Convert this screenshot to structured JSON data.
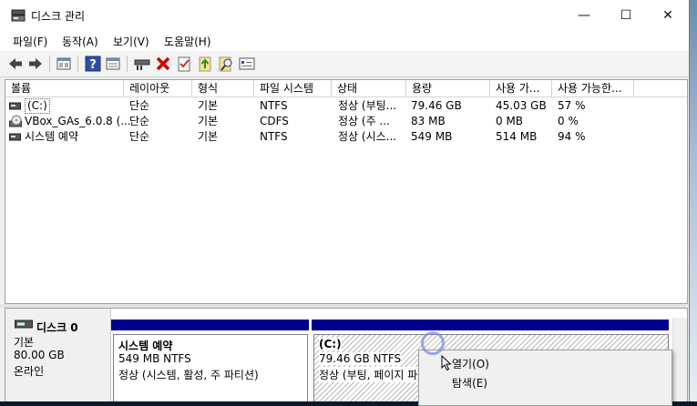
{
  "window": {
    "title": "디스크 관리",
    "controls": {
      "minimize": "—",
      "maximize": "☐",
      "close": "✕"
    }
  },
  "menubar": [
    "파일(F)",
    "동작(A)",
    "보기(V)",
    "도움말(H)"
  ],
  "toolbar": {
    "icons": [
      "back-icon",
      "forward-icon",
      "properties-icon",
      "help-icon",
      "view-icon",
      "connect-icon",
      "delete-icon",
      "check-icon",
      "import-icon",
      "search-icon",
      "rescan-icon"
    ]
  },
  "volume_list": {
    "columns": [
      "볼륨",
      "레이아웃",
      "형식",
      "파일 시스템",
      "상태",
      "용량",
      "사용 가...",
      "사용 가능한..."
    ],
    "rows": [
      {
        "volume": "(C:)",
        "layout": "단순",
        "type": "기본",
        "fs": "NTFS",
        "status": "정상 (부팅...",
        "capacity": "79.46 GB",
        "free": "45.03 GB",
        "pct": "57 %"
      },
      {
        "volume": "VBox_GAs_6.0.8 (...",
        "layout": "단순",
        "type": "기본",
        "fs": "CDFS",
        "status": "정상 (주 ...",
        "capacity": "83 MB",
        "free": "0 MB",
        "pct": "0 %"
      },
      {
        "volume": "시스템 예약",
        "layout": "단순",
        "type": "기본",
        "fs": "NTFS",
        "status": "정상 (시스...",
        "capacity": "549 MB",
        "free": "514 MB",
        "pct": "94 %"
      }
    ]
  },
  "disk0": {
    "name": "디스크 0",
    "kind": "기본",
    "size": "80.00 GB",
    "state": "온라인",
    "partitions": [
      {
        "name": "시스템 예약",
        "size": "549 MB NTFS",
        "status": "정상 (시스템, 활성, 주 파티션)"
      },
      {
        "name": "(C:)",
        "size": "79.46 GB NTFS",
        "status": "정상 (부팅, 페이지 파"
      }
    ]
  },
  "context_menu": {
    "items": [
      "열기(O)",
      "탐색(E)"
    ]
  }
}
